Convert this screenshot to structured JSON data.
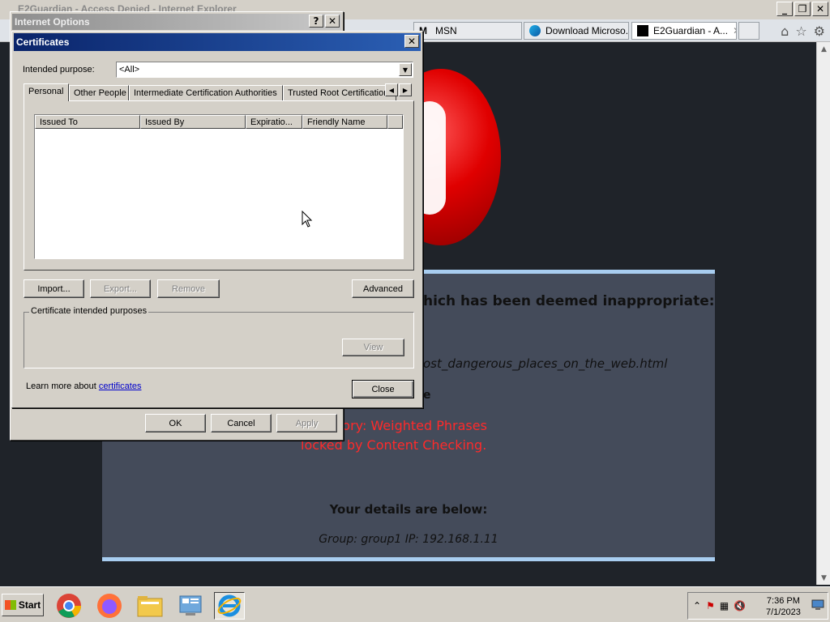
{
  "ie": {
    "title": "E2Guardian - Access Denied - Internet Explorer",
    "tabs": [
      {
        "label": "MSN"
      },
      {
        "label": "Download Microso..."
      },
      {
        "label": "E2Guardian - A..."
      }
    ]
  },
  "page": {
    "heading": "hich has been deemed inappropriate:",
    "url": "ost_dangerous_places_on_the_web.html",
    "partial": "e",
    "reason1": "tory: Weighted Phrases",
    "reason2": "locked by Content Checking.",
    "details_title": "Your details are below:",
    "group_ip": "Group: group1   IP: 192.168.1.11"
  },
  "internet_options": {
    "title": "Internet Options",
    "help": "?",
    "close": "✕",
    "ok": "OK",
    "cancel": "Cancel",
    "apply": "Apply"
  },
  "certificates": {
    "title": "Certificates",
    "close": "✕",
    "intended_purpose_label": "Intended purpose:",
    "intended_purpose_value": "<All>",
    "tabs": [
      "Personal",
      "Other People",
      "Intermediate Certification Authorities",
      "Trusted Root Certification"
    ],
    "columns": [
      "Issued To",
      "Issued By",
      "Expiratio...",
      "Friendly Name"
    ],
    "buttons": {
      "import": "Import...",
      "export": "Export...",
      "remove": "Remove",
      "advanced": "Advanced",
      "view": "View",
      "close": "Close"
    },
    "purposes_group": "Certificate intended purposes",
    "learn_more_prefix": "Learn more about ",
    "learn_more_link": "certificates"
  },
  "taskbar": {
    "start": "Start",
    "time": "7:36 PM",
    "date": "7/1/2023"
  }
}
